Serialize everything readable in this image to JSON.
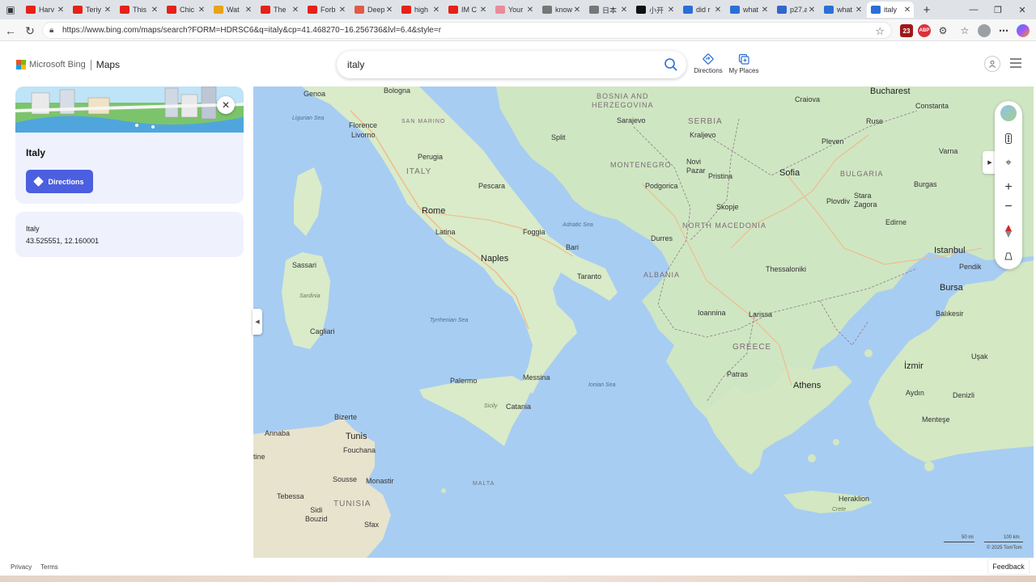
{
  "browser": {
    "tabs": [
      {
        "label": "Harv",
        "icon": "youtube-icon",
        "color": "#e62117"
      },
      {
        "label": "Teriy",
        "icon": "youtube-icon",
        "color": "#e62117"
      },
      {
        "label": "This",
        "icon": "youtube-icon",
        "color": "#e62117"
      },
      {
        "label": "Chic",
        "icon": "youtube-icon",
        "color": "#e62117"
      },
      {
        "label": "Wat",
        "icon": "chrome-icon",
        "color": "#e8a317"
      },
      {
        "label": "The",
        "icon": "youtube-icon",
        "color": "#e62117"
      },
      {
        "label": "Forb",
        "icon": "youtube-icon",
        "color": "#e62117"
      },
      {
        "label": "Deep",
        "icon": "deepseek-icon",
        "color": "#e05a4a"
      },
      {
        "label": "high",
        "icon": "youtube-icon",
        "color": "#e62117"
      },
      {
        "label": "IM C",
        "icon": "youtube-icon",
        "color": "#e62117"
      },
      {
        "label": "Your",
        "icon": "youtube-icon",
        "color": "#e98b9a"
      },
      {
        "label": "know",
        "icon": "x-icon",
        "color": "#777777"
      },
      {
        "label": "日本",
        "icon": "x-icon",
        "color": "#777777"
      },
      {
        "label": "小开",
        "icon": "x-icon",
        "color": "#111111"
      },
      {
        "label": "did r",
        "icon": "bing-search-icon",
        "color": "#2b6fd6"
      },
      {
        "label": "what",
        "icon": "bing-search-icon",
        "color": "#2b6fd6"
      },
      {
        "label": "p27.a",
        "icon": "wikipedia-icon",
        "color": "#3366cc"
      },
      {
        "label": "what",
        "icon": "bing-search-icon",
        "color": "#2b6fd6"
      },
      {
        "label": "italy",
        "icon": "bing-search-icon",
        "color": "#2b6fd6",
        "active": true
      }
    ],
    "new_tab": "+",
    "url": "https://www.bing.com/maps/search?FORM=HDRSC6&q=italy&cp=41.468270~16.256736&lvl=6.4&style=r",
    "ext_badge": "23",
    "ext_abp": "ABP"
  },
  "header": {
    "brand": "Microsoft Bing",
    "product": "Maps",
    "search_value": "italy",
    "directions_label": "Directions",
    "my_places_label": "My Places"
  },
  "panel": {
    "title": "Italy",
    "directions_button": "Directions",
    "coords_name": "Italy",
    "coords_value": "43.525551, 12.160001"
  },
  "map": {
    "labels": {
      "genoa": "Genoa",
      "bologna": "Bologna",
      "florence": "Florence",
      "livorno": "Livorno",
      "san_marino": "SAN MARINO",
      "ligurian_sea": "Ligurian Sea",
      "perugia": "Perugia",
      "italy": "ITALY",
      "pescara": "Pescara",
      "rome": "Rome",
      "latina": "Latina",
      "foggia": "Foggia",
      "bari": "Bari",
      "naples": "Naples",
      "taranto": "Taranto",
      "sassari": "Sassari",
      "sardinia": "Sardinia",
      "cagliari": "Cagliari",
      "tyrrhenian_sea": "Tyrrhenian Sea",
      "palermo": "Palermo",
      "messina": "Messina",
      "sicily": "Sicily",
      "catania": "Catania",
      "ionian_sea": "Ionian Sea",
      "adriatic_sea": "Adriatic Sea",
      "bizerte": "Bizerte",
      "annaba": "Annaba",
      "tunis": "Tunis",
      "fouchana": "Fouchana",
      "tine": "tine",
      "sousse": "Sousse",
      "monastir": "Monastir",
      "tebessa": "Tebessa",
      "tunisia": "TUNISIA",
      "sidi_bouzid": "Sidi\nBouzid",
      "sfax": "Sfax",
      "malta": "MALTA",
      "bosnia": "BOSNIA AND\nHERZEGOVINA",
      "sarajevo": "Sarajevo",
      "split": "Split",
      "montenegro": "MONTENEGRO",
      "podgorica": "Podgorica",
      "serbia": "SERBIA",
      "kraljevo": "Kraljevo",
      "novi_pazar": "Novi\nPazar",
      "pristina": "Pristina",
      "skopje": "Skopje",
      "north_macedonia": "NORTH MACEDONIA",
      "durres": "Durres",
      "albania": "ALBANIA",
      "ioannina": "Ioannina",
      "larissa": "Larissa",
      "greece": "GREECE",
      "patras": "Patras",
      "athens": "Athens",
      "thessaloniki": "Thessaloniki",
      "heraklion": "Heraklion",
      "crete": "Crete",
      "bucharest": "Bucharest",
      "craiova": "Craiova",
      "constanta": "Constanta",
      "ruse": "Ruse",
      "pleven": "Pleven",
      "varna": "Varna",
      "sofia": "Sofia",
      "bulgaria": "BULGARIA",
      "burgas": "Burgas",
      "plovdiv": "Plovdiv",
      "stara_zagora": "Stara\nZagora",
      "edirne": "Edirne",
      "istanbul": "Istanbul",
      "pendik": "Pendik",
      "bursa": "Bursa",
      "balikesir": "Balıkesir",
      "usak": "Uşak",
      "izmir": "İzmir",
      "aydin": "Aydın",
      "denizli": "Denizli",
      "mentese": "Menteşe"
    },
    "scale_mi": "50 mi",
    "scale_km": "100 km",
    "copyright": "© 2025 TomTom"
  },
  "footer": {
    "privacy": "Privacy",
    "terms": "Terms",
    "feedback": "Feedback"
  }
}
